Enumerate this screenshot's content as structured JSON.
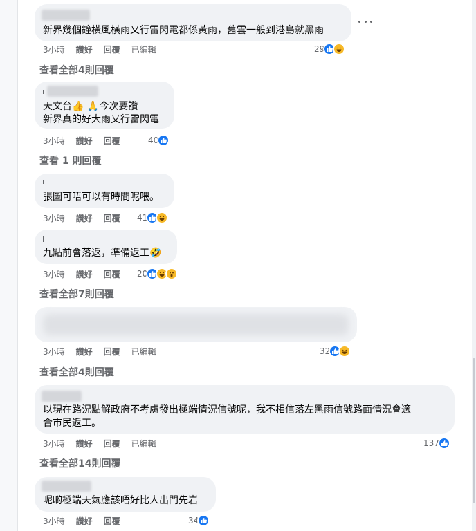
{
  "ui": {
    "accent_color": "#1877f2",
    "bubble_color": "#f0f2f5",
    "muted_text_color": "#65676b",
    "like_label": "讚好",
    "reply_label": "回覆",
    "edited_label": "已編輯"
  },
  "comments": [
    {
      "text_lines": [
        "新界幾個鐘橫風橫雨又行雷閃電都係黃雨，舊雲一般到港島就黑雨"
      ],
      "time": "3小時",
      "edited": true,
      "reaction_count": "29",
      "reactions": [
        "like-icon",
        "haha-icon"
      ],
      "view_replies": "查看全部4則回覆"
    },
    {
      "text_lines": [
        "天文台👍 🙏今次要讚",
        "新界真的好大雨又行雷閃電"
      ],
      "time": "3小時",
      "edited": false,
      "reaction_count": "40",
      "reactions": [
        "like-icon"
      ],
      "view_replies": "查看 1 則回覆"
    },
    {
      "text_lines": [
        "張圖可唔可以有時間呢喂。"
      ],
      "time": "3小時",
      "edited": false,
      "reaction_count": "41",
      "reactions": [
        "like-icon",
        "haha-icon"
      ],
      "view_replies": ""
    },
    {
      "text_lines": [
        "九點前會落返，準備返工🤣"
      ],
      "time": "3小時",
      "edited": false,
      "reaction_count": "20",
      "reactions": [
        "like-icon",
        "haha-icon",
        "wow-icon"
      ],
      "view_replies": "查看全部7則回覆"
    },
    {
      "text_lines": [],
      "time": "3小時",
      "edited": true,
      "reaction_count": "32",
      "reactions": [
        "like-icon",
        "haha-icon"
      ],
      "view_replies": "查看全部4則回覆"
    },
    {
      "text_lines": [
        "以現在路況點解政府不考慮發出極端情況信號呢，我不相信落左黑雨信號路面情況會適",
        "合市民返工。"
      ],
      "time": "3小時",
      "edited": true,
      "reaction_count": "137",
      "reactions": [
        "like-icon"
      ],
      "view_replies": "查看全部14則回覆"
    },
    {
      "text_lines": [
        "呢啲極端天氣應該唔好比人出門先岩"
      ],
      "time": "3小時",
      "edited": false,
      "reaction_count": "34",
      "reactions": [
        "like-icon"
      ],
      "view_replies": ""
    }
  ]
}
